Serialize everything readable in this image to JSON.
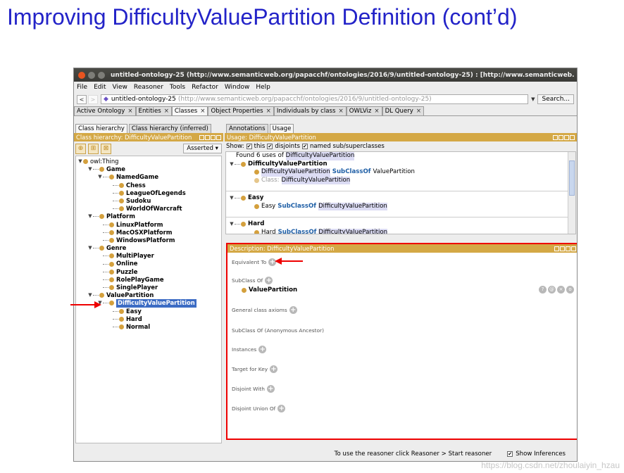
{
  "slide": {
    "title": "Improving DifficultyValuePartition Definition (cont’d)"
  },
  "window": {
    "title": "untitled-ontology-25 (http://www.semanticweb.org/papacchf/ontologies/2016/9/untitled-ontology-25) : [http://www.semanticweb."
  },
  "menu": [
    "File",
    "Edit",
    "View",
    "Reasoner",
    "Tools",
    "Refactor",
    "Window",
    "Help"
  ],
  "address": {
    "back": "<",
    "forward": ">",
    "ontology": "untitled-ontology-25",
    "iri": "(http://www.semanticweb.org/papacchf/ontologies/2016/9/untitled-ontology-25)",
    "search": "Search..."
  },
  "tabs": [
    "Active Ontology",
    "Entities",
    "Classes",
    "Object Properties",
    "Individuals by class",
    "OWLViz",
    "DL Query"
  ],
  "left": {
    "subtabs": [
      "Class hierarchy",
      "Class hierarchy (inferred)"
    ],
    "header": "Class hierarchy: DifficultyValuePartition",
    "asserted": "Asserted",
    "tree": [
      {
        "label": "owl:Thing",
        "depth": 0,
        "toggle": "▼"
      },
      {
        "label": "Game",
        "depth": 1,
        "toggle": "▼"
      },
      {
        "label": "NamedGame",
        "depth": 2,
        "toggle": "▼"
      },
      {
        "label": "Chess",
        "depth": 3,
        "toggle": ""
      },
      {
        "label": "LeagueOfLegends",
        "depth": 3,
        "toggle": ""
      },
      {
        "label": "Sudoku",
        "depth": 3,
        "toggle": ""
      },
      {
        "label": "WorldOfWarcraft",
        "depth": 3,
        "toggle": ""
      },
      {
        "label": "Platform",
        "depth": 1,
        "toggle": "▼"
      },
      {
        "label": "LinuxPlatform",
        "depth": 2,
        "toggle": ""
      },
      {
        "label": "MacOSXPlatform",
        "depth": 2,
        "toggle": ""
      },
      {
        "label": "WindowsPlatform",
        "depth": 2,
        "toggle": ""
      },
      {
        "label": "Genre",
        "depth": 1,
        "toggle": "▼"
      },
      {
        "label": "MultiPlayer",
        "depth": 2,
        "toggle": ""
      },
      {
        "label": "Online",
        "depth": 2,
        "toggle": ""
      },
      {
        "label": "Puzzle",
        "depth": 2,
        "toggle": ""
      },
      {
        "label": "RolePlayGame",
        "depth": 2,
        "toggle": ""
      },
      {
        "label": "SinglePlayer",
        "depth": 2,
        "toggle": ""
      },
      {
        "label": "ValuePartition",
        "depth": 1,
        "toggle": "▼"
      },
      {
        "label": "DifficultyValuePartition",
        "depth": 2,
        "toggle": "▼",
        "selected": true
      },
      {
        "label": "Easy",
        "depth": 3,
        "toggle": ""
      },
      {
        "label": "Hard",
        "depth": 3,
        "toggle": ""
      },
      {
        "label": "Normal",
        "depth": 3,
        "toggle": ""
      }
    ]
  },
  "right": {
    "subtabs": [
      "Annotations",
      "Usage"
    ],
    "usage_header": "Usage: DifficultyValuePartition",
    "show": {
      "label": "Show:",
      "this": "this",
      "disjoints": "disjoints",
      "named": "named sub/superclasses"
    },
    "found": {
      "prefix": "Found 6 uses of",
      "name": "DifficultyValuePartition"
    },
    "usage_groups": {
      "g1": {
        "name": "DifficultyValuePartition",
        "r1": {
          "a": "DifficultyValuePartition",
          "kw": "SubClassOf",
          "b": "ValuePartition"
        },
        "r2": {
          "kw": "Class:",
          "b": "DifficultyValuePartition"
        }
      },
      "g2": {
        "name": "Easy",
        "r1": {
          "a": "Easy",
          "kw": "SubClassOf",
          "b": "DifficultyValuePartition"
        }
      },
      "g3": {
        "name": "Hard",
        "r1": {
          "a": "Hard",
          "kw": "SubClassOf",
          "b": "DifficultyValuePartition"
        }
      }
    },
    "desc_header": "Description: DifficultyValuePartition",
    "sections": {
      "equivalent": "Equivalent To",
      "subclass": "SubClass Of",
      "subclass_value": "ValuePartition",
      "gca": "General class axioms",
      "anon": "SubClass Of (Anonymous Ancestor)",
      "instances": "Instances",
      "target": "Target for Key",
      "disjoint": "Disjoint With",
      "disjoint_union": "Disjoint Union Of"
    }
  },
  "status": {
    "message": "To use the reasoner click Reasoner > Start reasoner",
    "show_inferences": "Show Inferences"
  },
  "watermark": "https://blog.csdn.net/zhoulaiyin_hzau",
  "colors": {
    "title": "#2323c8",
    "header": "#d4a845",
    "selected": "#3c6cc4",
    "annotation": "#e00000"
  }
}
